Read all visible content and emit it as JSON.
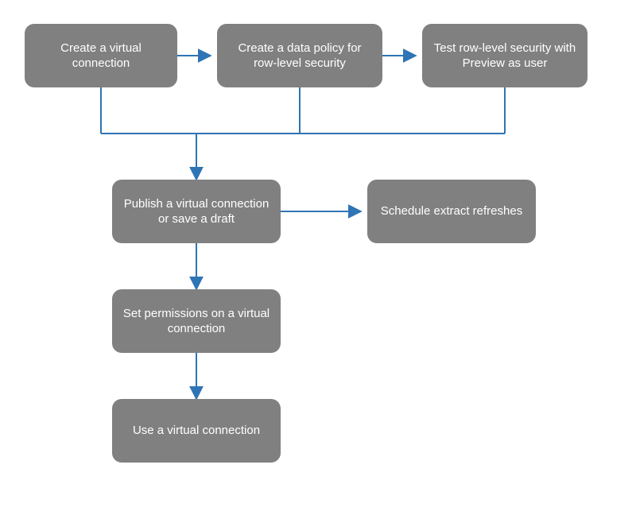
{
  "nodes": {
    "create_vc": "Create a virtual connection",
    "create_policy": "Create a data policy for row-level security",
    "test_rls": "Test row-level security with Preview as user",
    "publish": "Publish a virtual connection or save a draft",
    "schedule": "Schedule extract refreshes",
    "permissions": "Set permissions on a virtual connection",
    "use_vc": "Use a virtual connection"
  },
  "colors": {
    "node_bg": "#808080",
    "node_text": "#ffffff",
    "arrow": "#2f75b5"
  }
}
